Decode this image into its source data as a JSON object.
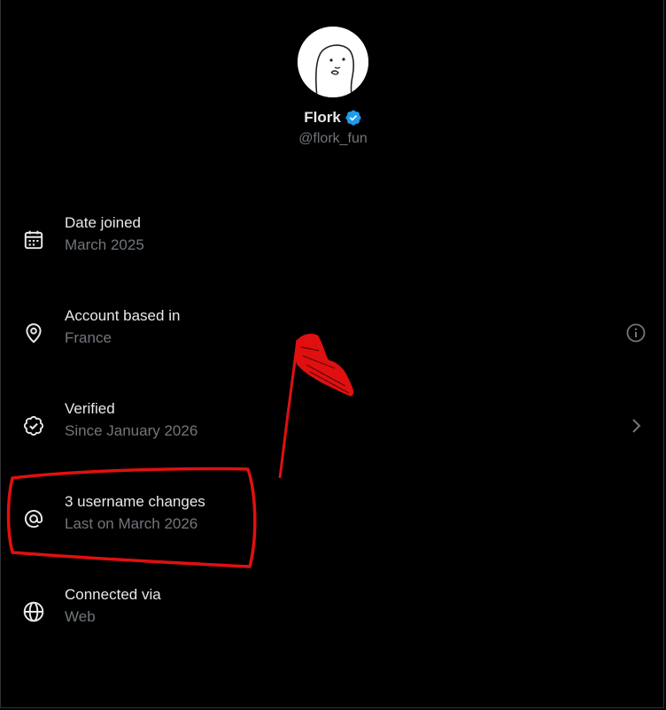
{
  "profile": {
    "display_name": "Flork",
    "handle": "@flork_fun",
    "verified_icon": "verified-badge-icon",
    "badge_color": "#1d9bf0"
  },
  "rows": [
    {
      "title": "Date joined",
      "subtitle": "March 2025",
      "icon": "calendar-icon"
    },
    {
      "title": "Account based in",
      "subtitle": "France",
      "icon": "location-pin-icon",
      "trailing_icon": "info-icon"
    },
    {
      "title": "Verified",
      "subtitle": "Since January 2026",
      "icon": "verified-check-icon",
      "trailing_icon": "chevron-right-icon"
    },
    {
      "title": "3 username changes",
      "subtitle": "Last on March 2026",
      "icon": "at-sign-icon"
    },
    {
      "title": "Connected via",
      "subtitle": "Web",
      "icon": "globe-icon"
    }
  ],
  "colors": {
    "background": "#000000",
    "primary_text": "#e7e9ea",
    "secondary_text": "#71767b",
    "annotation": "#e01010"
  }
}
